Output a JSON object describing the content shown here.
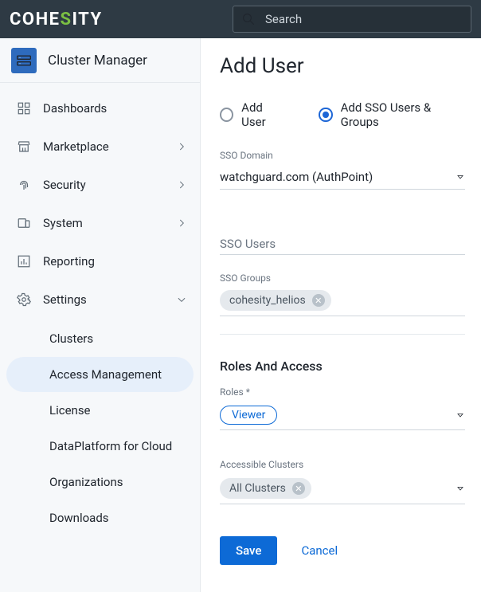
{
  "brand": {
    "prefix": "COHE",
    "green": "S",
    "suffix": "ITY"
  },
  "search": {
    "placeholder": "Search"
  },
  "sidebar": {
    "title": "Cluster Manager",
    "items": [
      {
        "label": "Dashboards",
        "expandable": false
      },
      {
        "label": "Marketplace",
        "expandable": true
      },
      {
        "label": "Security",
        "expandable": true
      },
      {
        "label": "System",
        "expandable": true
      },
      {
        "label": "Reporting",
        "expandable": false
      },
      {
        "label": "Settings",
        "expandable": true,
        "open": true,
        "children": [
          {
            "label": "Clusters"
          },
          {
            "label": "Access Management",
            "active": true
          },
          {
            "label": "License"
          },
          {
            "label": "DataPlatform for Cloud"
          },
          {
            "label": "Organizations"
          },
          {
            "label": "Downloads"
          }
        ]
      }
    ]
  },
  "page": {
    "title": "Add User",
    "radios": {
      "addUser": "Add User",
      "addSso": "Add SSO Users & Groups",
      "selected": "addSso"
    },
    "ssoDomain": {
      "label": "SSO Domain",
      "value": "watchguard.com (AuthPoint)"
    },
    "ssoUsers": {
      "label": "SSO Users"
    },
    "ssoGroups": {
      "label": "SSO Groups",
      "chips": [
        "cohesity_helios"
      ]
    },
    "rolesSection": "Roles And Access",
    "roles": {
      "label": "Roles *",
      "chips": [
        "Viewer"
      ]
    },
    "clusters": {
      "label": "Accessible Clusters",
      "chips": [
        "All Clusters"
      ]
    },
    "save": "Save",
    "cancel": "Cancel"
  }
}
